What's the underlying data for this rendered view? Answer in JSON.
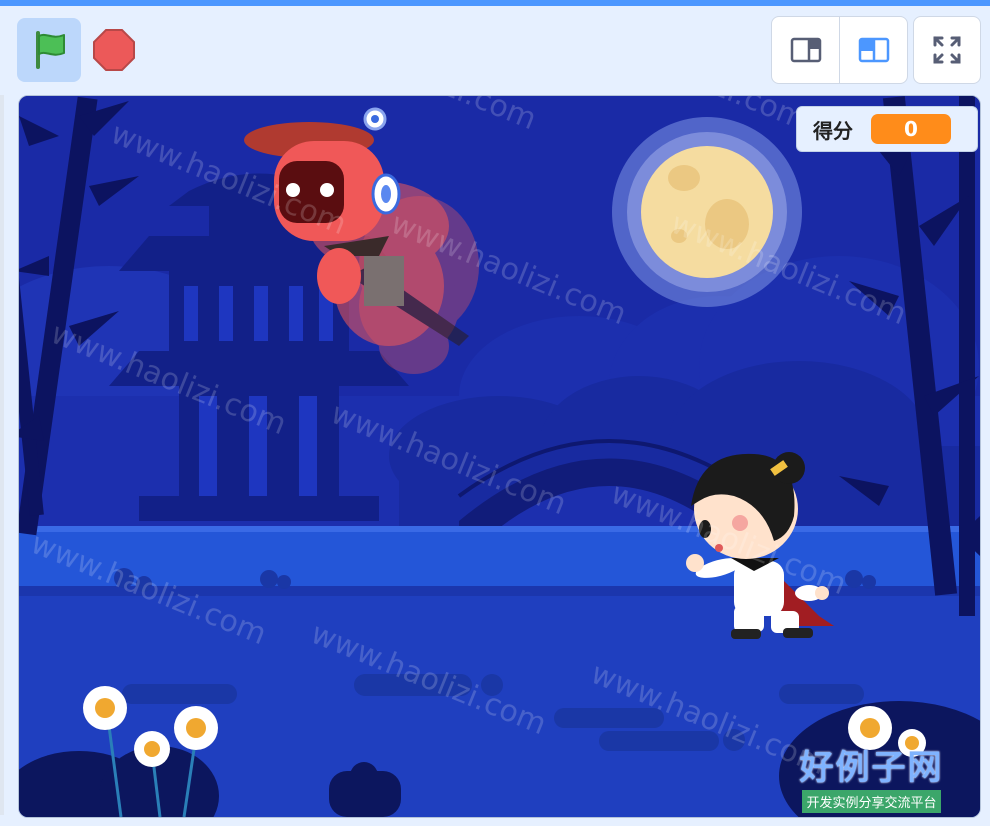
{
  "toolbar": {
    "flag_icon": "green-flag-icon",
    "stop_icon": "stop-sign-icon",
    "small_stage_icon": "small-stage-icon",
    "large_stage_icon": "large-stage-icon",
    "fullscreen_icon": "fullscreen-icon",
    "colors": {
      "flag": "#4cbf56",
      "stop": "#ec5959",
      "accent": "#4c97ff"
    }
  },
  "score": {
    "label": "得分",
    "value": "0",
    "color": "#ff8c1a"
  },
  "watermark": {
    "url_text": "www.haolizi.com",
    "logo_title": "好例子网",
    "logo_subtitle": "开发实例分享交流平台"
  }
}
